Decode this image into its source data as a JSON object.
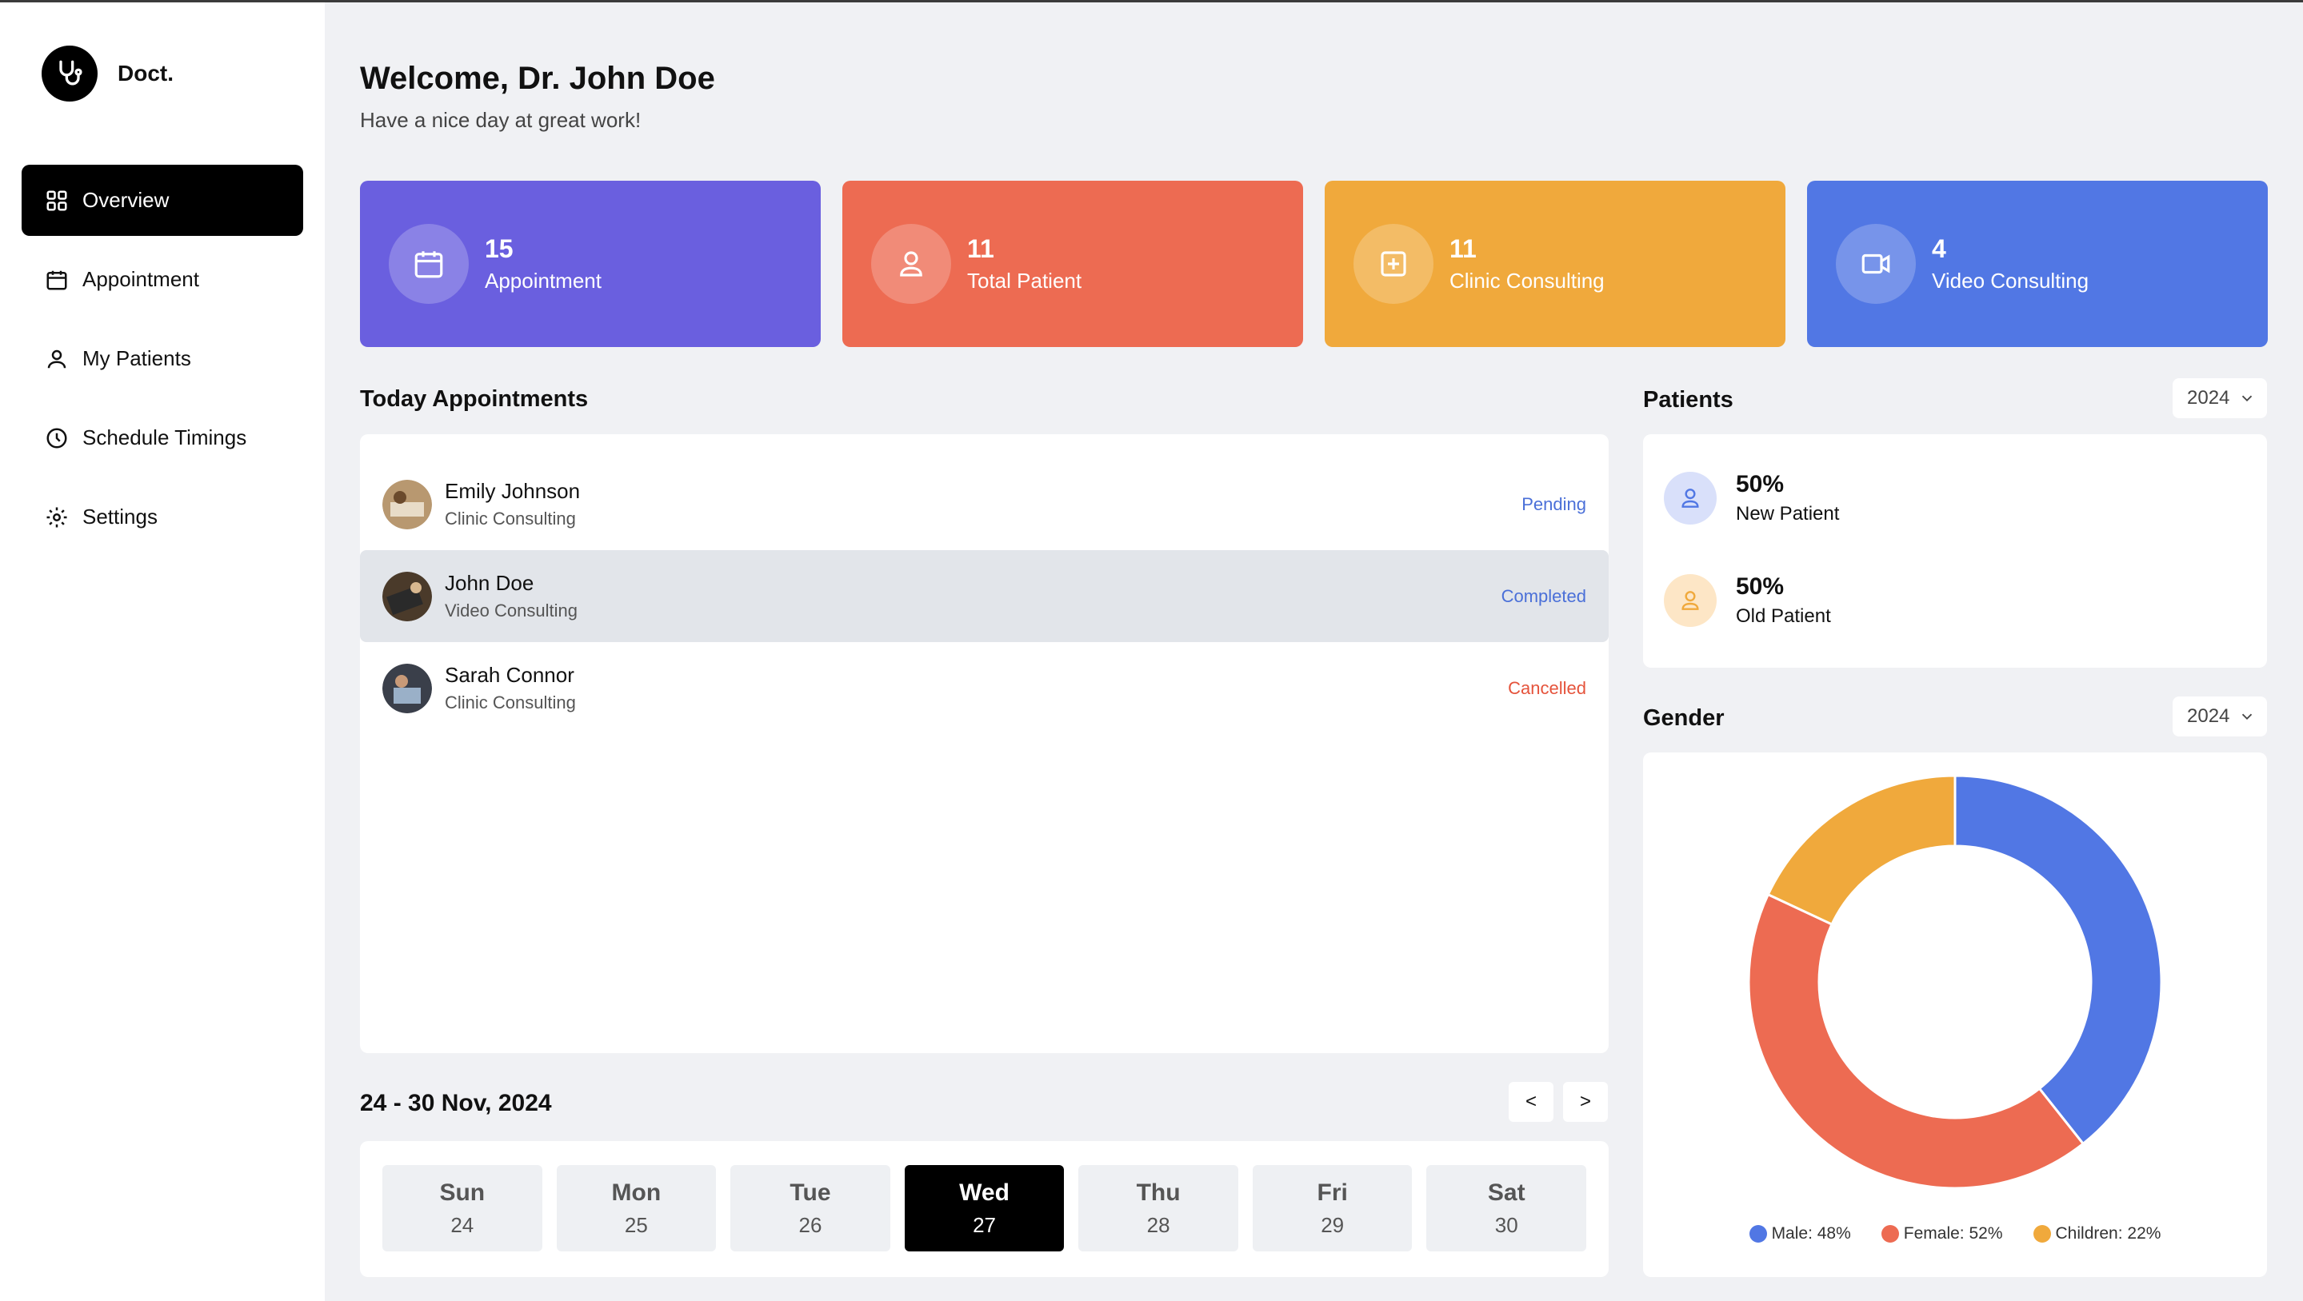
{
  "app": {
    "name": "Doct."
  },
  "nav": [
    {
      "label": "Overview",
      "icon": "grid-icon",
      "active": true
    },
    {
      "label": "Appointment",
      "icon": "calendar-icon"
    },
    {
      "label": "My Patients",
      "icon": "user-icon"
    },
    {
      "label": "Schedule Timings",
      "icon": "clock-icon"
    },
    {
      "label": "Settings",
      "icon": "gear-icon"
    }
  ],
  "header": {
    "title": "Welcome, Dr. John Doe",
    "subtitle": "Have a nice day at great work!"
  },
  "stats": [
    {
      "value": "15",
      "label": "Appointment",
      "color": "#6a5fdf",
      "icon": "calendar-icon"
    },
    {
      "value": "11",
      "label": "Total Patient",
      "color": "#ed6b52",
      "icon": "user-icon"
    },
    {
      "value": "11",
      "label": "Clinic Consulting",
      "color": "#f0a93c",
      "icon": "medical-plus-icon"
    },
    {
      "value": "4",
      "label": "Video Consulting",
      "color": "#5177e4",
      "icon": "video-icon"
    }
  ],
  "appointments": {
    "title": "Today Appointments",
    "items": [
      {
        "name": "Emily Johnson",
        "type": "Clinic Consulting",
        "status": "Pending",
        "status_color": "#4a6fd8"
      },
      {
        "name": "John Doe",
        "type": "Video Consulting",
        "status": "Completed",
        "status_color": "#4a6fd8"
      },
      {
        "name": "Sarah Connor",
        "type": "Clinic Consulting",
        "status": "Cancelled",
        "status_color": "#e5533b"
      }
    ]
  },
  "week": {
    "title": "24 - 30 Nov, 2024",
    "prev": "<",
    "next": ">",
    "days": [
      {
        "name": "Sun",
        "num": "24"
      },
      {
        "name": "Mon",
        "num": "25"
      },
      {
        "name": "Tue",
        "num": "26"
      },
      {
        "name": "Wed",
        "num": "27",
        "active": true
      },
      {
        "name": "Thu",
        "num": "28"
      },
      {
        "name": "Fri",
        "num": "29"
      },
      {
        "name": "Sat",
        "num": "30"
      }
    ]
  },
  "patients": {
    "title": "Patients",
    "year": "2024",
    "new": {
      "pct": "50%",
      "label": "New Patient"
    },
    "old": {
      "pct": "50%",
      "label": "Old Patient"
    }
  },
  "gender": {
    "title": "Gender",
    "year": "2024"
  },
  "chart_data": {
    "type": "pie",
    "categories": [
      "Male",
      "Female",
      "Children"
    ],
    "values": [
      48,
      52,
      22
    ],
    "colors": [
      "#5177e4",
      "#ed6b52",
      "#f0a93c"
    ],
    "legend": [
      "Male: 48%",
      "Female: 52%",
      "Children: 22%"
    ],
    "donut": true,
    "legend_position": "bottom"
  }
}
